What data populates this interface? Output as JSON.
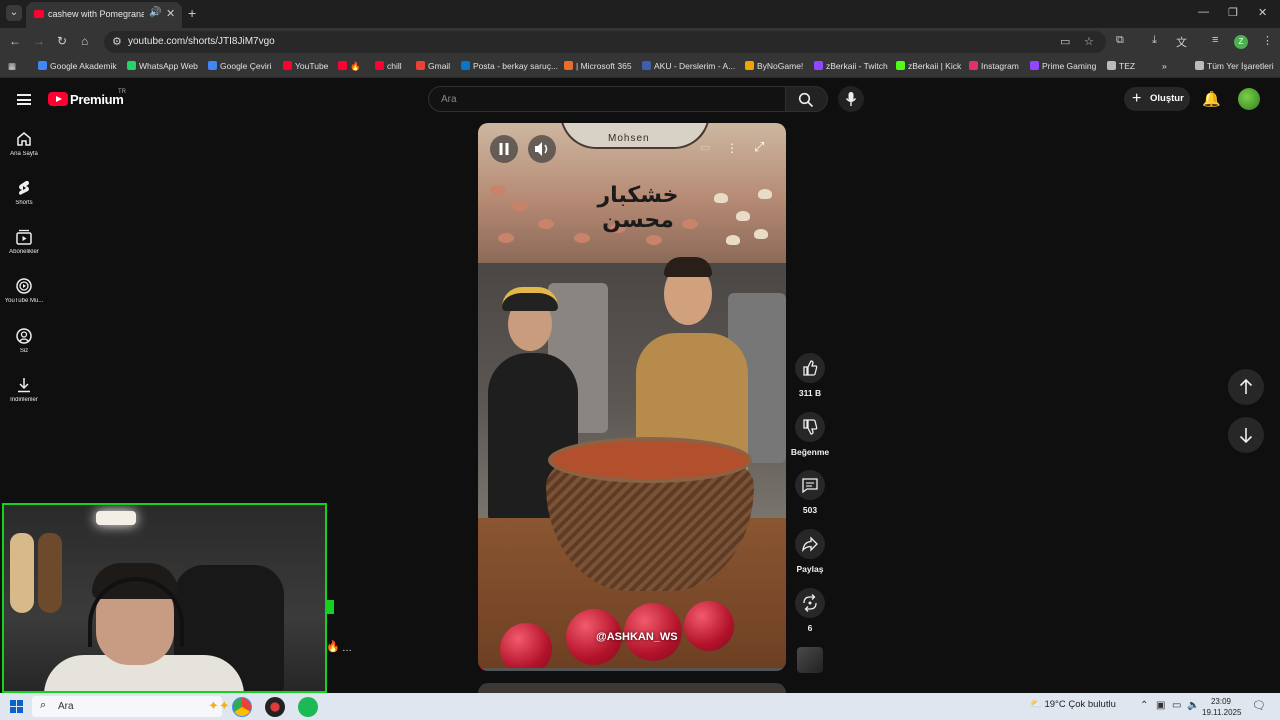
{
  "browser": {
    "tab_title": "cashew with Pomegranate |",
    "url": "youtube.com/shorts/JTI8JiM7vgo",
    "profile_initial": "Z",
    "bookmarks": [
      {
        "label": "Google Akademik",
        "color": "#4285f4"
      },
      {
        "label": "WhatsApp Web",
        "color": "#25d366"
      },
      {
        "label": "Google Çeviri",
        "color": "#4285f4"
      },
      {
        "label": "YouTube",
        "color": "#ff0033"
      },
      {
        "label": "",
        "color": "#ff0033"
      },
      {
        "label": "chill",
        "color": "#ff0033"
      },
      {
        "label": "Gmail",
        "color": "#ea4335"
      },
      {
        "label": "Posta - berkay saruç...",
        "color": "#0078d4"
      },
      {
        "label": "| Microsoft 365",
        "color": "#e96d2b"
      },
      {
        "label": "AKU - Derslerim - A...",
        "color": "#3f5fa8"
      },
      {
        "label": "ByNoGame!",
        "color": "#f0a500"
      },
      {
        "label": "zBerkaii - Twitch",
        "color": "#9146ff"
      },
      {
        "label": "zBerkaii | Kick",
        "color": "#53fc18"
      },
      {
        "label": "Instagram",
        "color": "#e1306c"
      },
      {
        "label": "Prime Gaming",
        "color": "#9146ff"
      },
      {
        "label": "TEZ",
        "color": "#bbbbbb"
      },
      {
        "label": "Tüm Yer İşaretleri",
        "color": "#bbbbbb"
      }
    ]
  },
  "youtube": {
    "brand": "Premium",
    "region": "TR",
    "search_placeholder": "Ara",
    "create_label": "Oluştur",
    "sidebar": [
      {
        "label": "Ana Sayfa",
        "icon": "home-icon"
      },
      {
        "label": "Shorts",
        "icon": "shorts-icon"
      },
      {
        "label": "Abonelikler",
        "icon": "subscriptions-icon"
      },
      {
        "label": "YouTube Mu...",
        "icon": "youtube-music-icon"
      },
      {
        "label": "Siz",
        "icon": "you-icon"
      },
      {
        "label": "İndirilenler",
        "icon": "downloads-icon"
      }
    ],
    "video": {
      "sign_text": "Mohsen",
      "caption": "خشکبار محسن",
      "watermark": "@ASHKAN_WS",
      "progress_fraction": 0.02
    },
    "actions": {
      "like_count": "311 B",
      "dislike_label": "Beğenme",
      "comment_count": "503",
      "share_label": "Paylaş",
      "remix_count": "6"
    },
    "accent_color": "#ff0033"
  },
  "taskbar": {
    "search_text": "Ara",
    "weather": "19°C  Çok bulutlu",
    "time": "23:09",
    "date": "19.11.2025"
  }
}
